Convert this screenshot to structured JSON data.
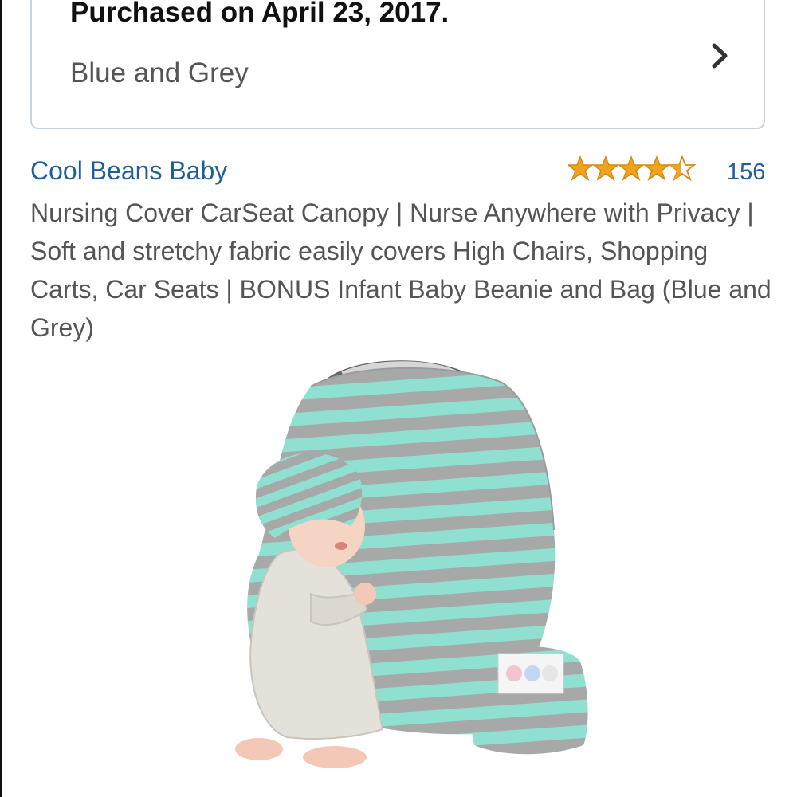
{
  "purchase": {
    "title": "Purchased on April 23, 2017.",
    "variant": "Blue and Grey"
  },
  "product": {
    "brand": "Cool Beans Baby",
    "rating": 4.5,
    "rating_max": 5,
    "rating_count": "156",
    "title": "Nursing Cover CarSeat Canopy | Nurse Anywhere with Privacy | Soft and stretchy fabric easily covers High Chairs, Shopping Carts, Car Seats | BONUS Infant Baby Beanie and Bag (Blue and Grey)"
  },
  "icons": {
    "chevron": "chevron-right-icon",
    "star": "star-icon"
  },
  "colors": {
    "link": "#1f5e9c",
    "star": "#f0a31c",
    "star_outline": "#d28a10",
    "stripe_mint": "#8fe0d0",
    "stripe_grey": "#a7a9a8"
  }
}
